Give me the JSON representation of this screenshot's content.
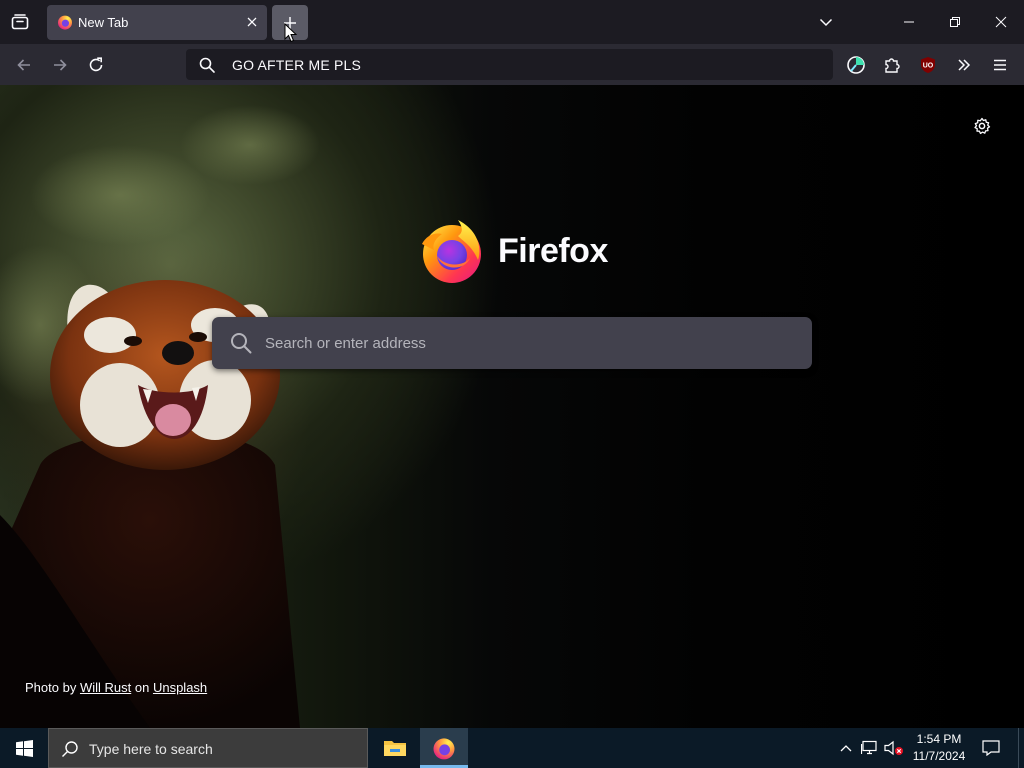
{
  "browser": {
    "tab": {
      "title": "New Tab"
    },
    "urlbar": {
      "value": "GO AFTER ME PLS"
    }
  },
  "newtab": {
    "brand": "Firefox",
    "search_placeholder": "Search or enter address",
    "credit": {
      "prefix": "Photo by",
      "author": "Will Rust",
      "middle": "on",
      "site": "Unsplash"
    }
  },
  "taskbar": {
    "search_placeholder": "Type here to search",
    "time": "1:54 PM",
    "date": "11/7/2024"
  },
  "colors": {
    "titlebar": "#1c1b22",
    "toolbar": "#2b2a33",
    "active_tab": "#42414d",
    "search_box": "#42414d",
    "taskbar": "#0b1a27",
    "ublock_red": "#800000"
  },
  "icons": {
    "firefox_view": "firefox-view-icon",
    "tab_close": "close-icon",
    "new_tab": "plus-icon",
    "list_all_tabs": "chevron-down-icon",
    "back": "arrow-left-icon",
    "forward": "arrow-right-icon",
    "reload": "reload-icon",
    "urlbar_search": "search-icon",
    "tracking": "tracking-protection-icon",
    "extensions": "puzzle-piece-icon",
    "ublock": "ublock-origin-icon",
    "overflow": "chevron-double-right-icon",
    "menu": "hamburger-menu-icon",
    "settings": "gear-icon",
    "windows_start": "windows-logo-icon",
    "file_explorer": "folder-icon",
    "tray_overflow": "chevron-up-icon",
    "network": "network-icon",
    "volume": "speaker-muted-icon",
    "action_center": "notification-icon"
  }
}
